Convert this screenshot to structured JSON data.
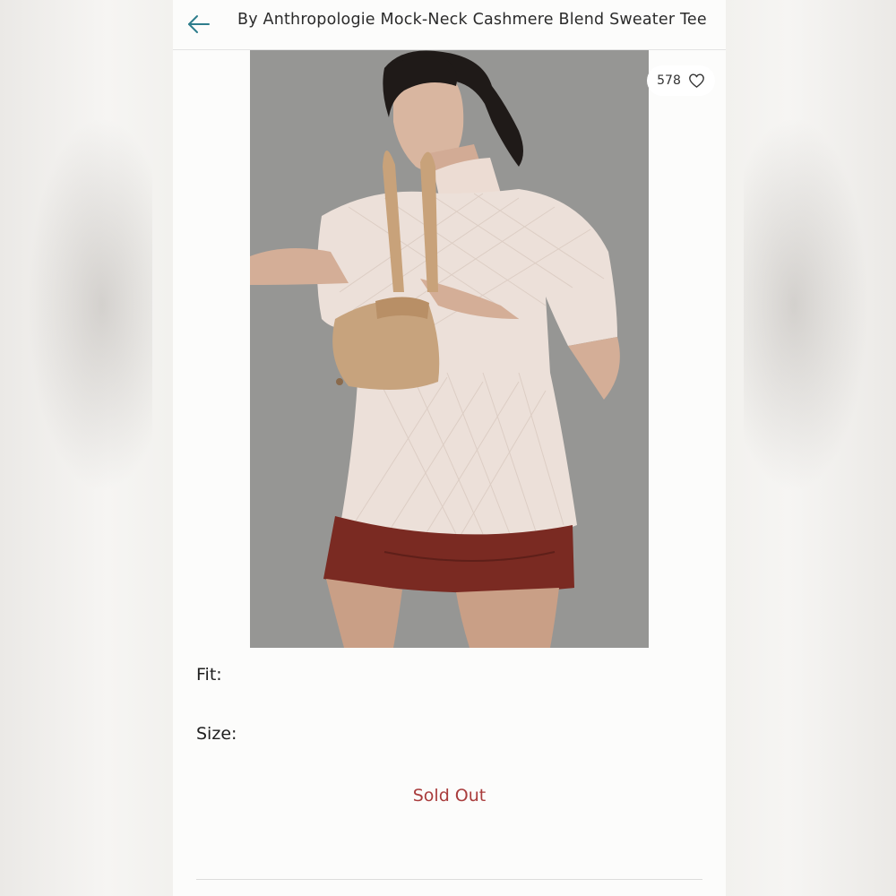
{
  "header": {
    "title": "By Anthropologie Mock-Neck Cashmere Blend Sweater Tee"
  },
  "icons": {
    "back": "back-arrow-icon",
    "like": "heart-icon"
  },
  "product": {
    "likes": "578",
    "image_alt": "Model wearing cream knit mock-neck sweater tee with tan handbag and red leather skirt"
  },
  "options": {
    "fit_label": "Fit:",
    "size_label": "Size:"
  },
  "status": {
    "sold_out": "Sold Out"
  },
  "colors": {
    "accent_back_arrow": "#2e7d8c",
    "sold_out": "#a93c3c",
    "photo_background": "#969694"
  }
}
